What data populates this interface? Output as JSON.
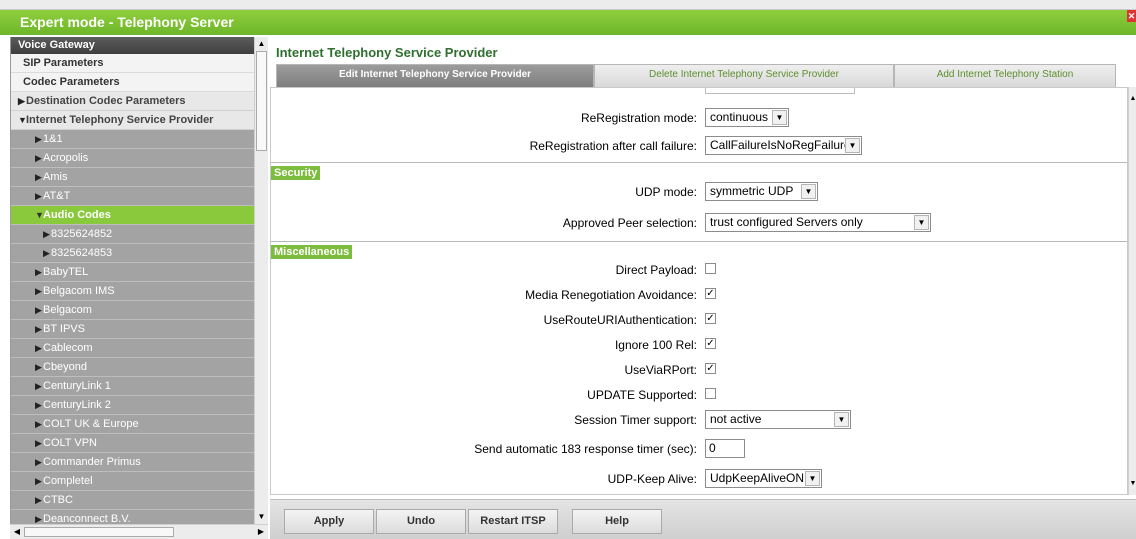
{
  "window": {
    "title": "Expert mode - Telephony Server"
  },
  "sidebar": {
    "header": "Voice Gateway",
    "items": [
      {
        "label": "SIP Parameters",
        "style": "light",
        "level": 1,
        "arrow": ""
      },
      {
        "label": "Codec Parameters",
        "style": "light",
        "level": 1,
        "arrow": ""
      },
      {
        "label": "Destination Codec Parameters",
        "style": "mid",
        "level": 0,
        "arrow": "▶"
      },
      {
        "label": "Internet Telephony Service Provider",
        "style": "mid",
        "level": 0,
        "arrow": "▼"
      },
      {
        "label": "1&1",
        "style": "gray",
        "level": 2,
        "arrow": "▶"
      },
      {
        "label": "Acropolis",
        "style": "gray",
        "level": 2,
        "arrow": "▶"
      },
      {
        "label": "Amis",
        "style": "gray",
        "level": 2,
        "arrow": "▶"
      },
      {
        "label": "AT&T",
        "style": "gray",
        "level": 2,
        "arrow": "▶"
      },
      {
        "label": "Audio Codes",
        "style": "active",
        "level": 2,
        "arrow": "▼"
      },
      {
        "label": "8325624852",
        "style": "gray",
        "level": 3,
        "arrow": "▶"
      },
      {
        "label": "8325624853",
        "style": "gray",
        "level": 3,
        "arrow": "▶"
      },
      {
        "label": "BabyTEL",
        "style": "gray",
        "level": 2,
        "arrow": "▶"
      },
      {
        "label": "Belgacom IMS",
        "style": "gray",
        "level": 2,
        "arrow": "▶"
      },
      {
        "label": "Belgacom",
        "style": "gray",
        "level": 2,
        "arrow": "▶"
      },
      {
        "label": "BT IPVS",
        "style": "gray",
        "level": 2,
        "arrow": "▶"
      },
      {
        "label": "Cablecom",
        "style": "gray",
        "level": 2,
        "arrow": "▶"
      },
      {
        "label": "Cbeyond",
        "style": "gray",
        "level": 2,
        "arrow": "▶"
      },
      {
        "label": "CenturyLink 1",
        "style": "gray",
        "level": 2,
        "arrow": "▶"
      },
      {
        "label": "CenturyLink 2",
        "style": "gray",
        "level": 2,
        "arrow": "▶"
      },
      {
        "label": "COLT UK & Europe",
        "style": "gray",
        "level": 2,
        "arrow": "▶"
      },
      {
        "label": "COLT VPN",
        "style": "gray",
        "level": 2,
        "arrow": "▶"
      },
      {
        "label": "Commander Primus",
        "style": "gray",
        "level": 2,
        "arrow": "▶"
      },
      {
        "label": "Completel",
        "style": "gray",
        "level": 2,
        "arrow": "▶"
      },
      {
        "label": "CTBC",
        "style": "gray",
        "level": 2,
        "arrow": "▶"
      },
      {
        "label": "Deanconnect B.V.",
        "style": "gray",
        "level": 2,
        "arrow": "▶"
      }
    ]
  },
  "main": {
    "title": "Internet Telephony Service Provider",
    "tabs": [
      {
        "label": "Edit Internet Telephony Service Provider",
        "active": true
      },
      {
        "label": "Delete Internet Telephony Service Provider",
        "active": false
      },
      {
        "label": "Add Internet Telephony Station",
        "active": false
      }
    ],
    "fields": {
      "reregistration_mode": {
        "label": "ReRegistration mode:",
        "value": "continuous"
      },
      "reregistration_after_failure": {
        "label": "ReRegistration after call failure:",
        "value": "CallFailureIsNoRegFailure"
      },
      "security_section": "Security",
      "udp_mode": {
        "label": "UDP mode:",
        "value": "symmetric UDP"
      },
      "approved_peer": {
        "label": "Approved Peer selection:",
        "value": "trust configured Servers only"
      },
      "misc_section": "Miscellaneous",
      "direct_payload": {
        "label": "Direct Payload:",
        "checked": false
      },
      "media_reneg": {
        "label": "Media Renegotiation Avoidance:",
        "checked": true
      },
      "use_route_uri": {
        "label": "UseRouteURIAuthentication:",
        "checked": true
      },
      "ignore_100rel": {
        "label": "Ignore 100 Rel:",
        "checked": true
      },
      "use_via_rport": {
        "label": "UseViaRPort:",
        "checked": true
      },
      "update_supported": {
        "label": "UPDATE Supported:",
        "checked": false
      },
      "session_timer": {
        "label": "Session Timer support:",
        "value": "not active"
      },
      "auto_183": {
        "label": "Send automatic 183 response timer (sec):",
        "value": "0"
      },
      "udp_keepalive": {
        "label": "UDP-Keep Alive:",
        "value": "UdpKeepAliveON"
      }
    },
    "buttons": {
      "apply": "Apply",
      "undo": "Undo",
      "restart": "Restart ITSP",
      "help": "Help"
    }
  },
  "colors": {
    "accent": "#7dbd3d",
    "title_green": "#2f6f2f",
    "sidebar_gray": "#a3a3a3"
  }
}
